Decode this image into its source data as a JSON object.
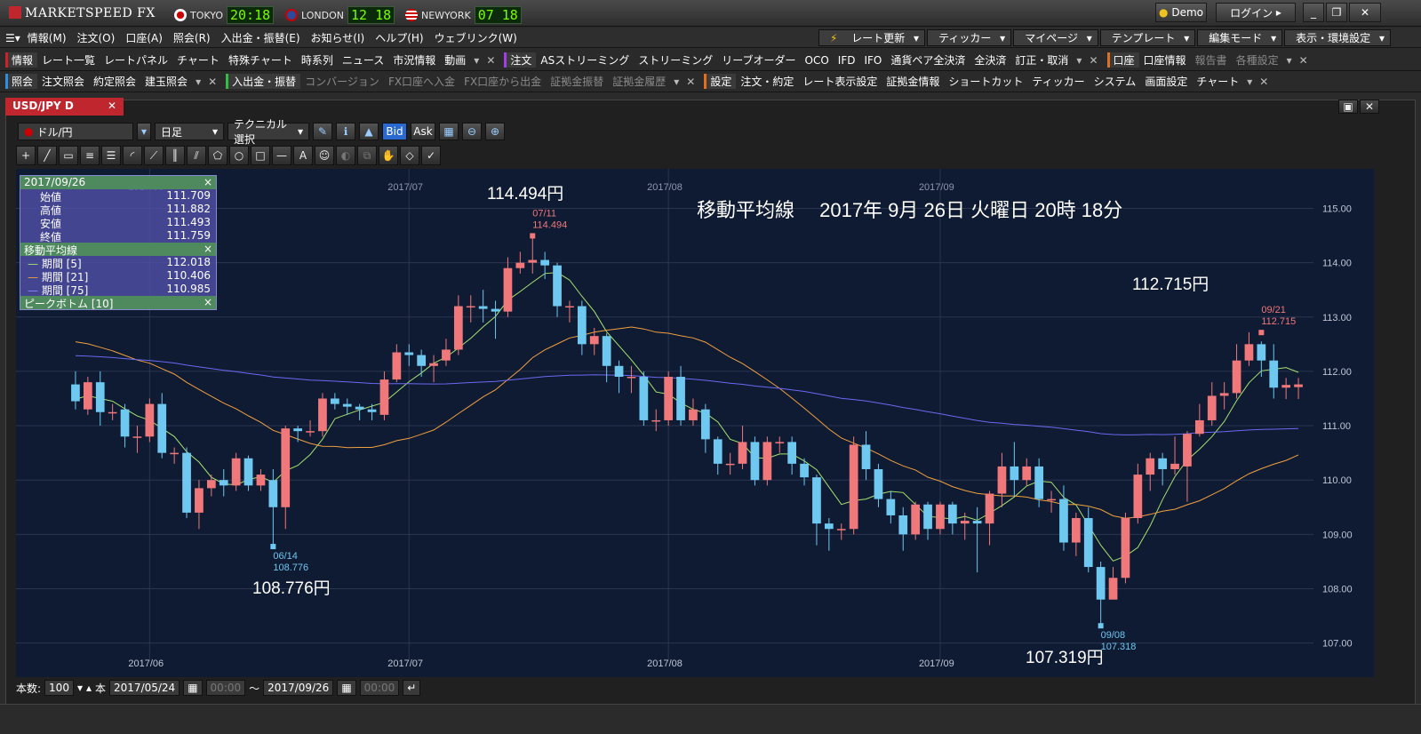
{
  "app": {
    "title": "MARKETSPEED FX"
  },
  "clocks": [
    {
      "city": "TOKYO",
      "time": "20:18"
    },
    {
      "city": "LONDON",
      "time": "12 18"
    },
    {
      "city": "NEWYORK",
      "time": "07 18"
    }
  ],
  "top_right": {
    "demo": "Demo",
    "login": "ログイン"
  },
  "menu": [
    "情報(M)",
    "注文(O)",
    "口座(A)",
    "照会(R)",
    "入出金・振替(E)",
    "お知らせ(I)",
    "ヘルプ(H)",
    "ウェブリンク(W)"
  ],
  "menu_right": [
    "レート更新",
    "ティッカー",
    "マイページ",
    "テンプレート",
    "編集モード",
    "表示・環境設定"
  ],
  "toolbar1": {
    "info_group": "情報",
    "info_items": [
      "レート一覧",
      "レートパネル",
      "チャート",
      "特殊チャート",
      "時系列",
      "ニュース",
      "市況情報",
      "動画"
    ],
    "order_group": "注文",
    "order_items": [
      "ASストリーミング",
      "ストリーミング",
      "リーブオーダー",
      "OCO",
      "IFD",
      "IFO",
      "通貨ペア全決済",
      "全決済",
      "訂正・取消"
    ],
    "account_group": "口座",
    "account_items": [
      "口座情報",
      "報告書",
      "各種設定"
    ]
  },
  "toolbar2": {
    "inquiry_group": "照会",
    "inquiry_items": [
      "注文照会",
      "約定照会",
      "建玉照会"
    ],
    "transfer_group": "入出金・振替",
    "transfer_items": [
      "コンバージョン",
      "FX口座へ入金",
      "FX口座から出金",
      "証拠金振替",
      "証拠金履歴"
    ],
    "settings_group": "設定",
    "settings_items": [
      "注文・約定",
      "レート表示設定",
      "証拠金情報",
      "ショートカット",
      "ティッカー",
      "システム",
      "画面設定",
      "チャート"
    ]
  },
  "panel": {
    "tab": "USD/JPY D",
    "pair": "ドル/円",
    "period": "日足",
    "technical": "テクニカル選択",
    "bid": "Bid",
    "ask": "Ask"
  },
  "info": {
    "date": "2017/09/26",
    "ohlc": [
      {
        "label": "始値",
        "value": "111.709"
      },
      {
        "label": "高値",
        "value": "111.882"
      },
      {
        "label": "安値",
        "value": "111.493"
      },
      {
        "label": "終値",
        "value": "111.759"
      }
    ],
    "ma_title": "移動平均線",
    "ma": [
      {
        "label": "期間 [5]",
        "value": "112.018",
        "color": "#a6e36f"
      },
      {
        "label": "期間 [21]",
        "value": "110.406",
        "color": "#f0a040"
      },
      {
        "label": "期間 [75]",
        "value": "110.985",
        "color": "#6a6af0"
      }
    ],
    "peak_title": "ピークボトム [10]"
  },
  "annotations": {
    "headline": "移動平均線　 2017年 9月 26日 火曜日 20時 18分",
    "high1": "114.494円",
    "high2": "112.715円",
    "low1": "108.776円",
    "low2": "107.319円",
    "peak1_date": "07/11",
    "peak1_val": "114.494",
    "peak2_date": "09/21",
    "peak2_val": "112.715",
    "bottom1_date": "06/14",
    "bottom1_val": "108.776",
    "bottom2_date": "09/08",
    "bottom2_val": "107.318"
  },
  "bottom": {
    "count_label": "本数:",
    "count": "100",
    "unit": "本",
    "from": "2017/05/24",
    "from_time": "00:00",
    "tilde": "〜",
    "to": "2017/09/26",
    "to_time": "00:00"
  },
  "chart_data": {
    "type": "candlestick",
    "ylim": [
      106.7,
      115.4
    ],
    "yticks": [
      "107.00",
      "108.00",
      "109.00",
      "110.00",
      "111.00",
      "112.00",
      "113.00",
      "114.00",
      "115.00"
    ],
    "xticks": [
      "2017/06",
      "2017/07",
      "2017/08",
      "2017/09"
    ],
    "colors": {
      "up": "#f0787a",
      "down": "#6ec8f0",
      "ma5": "#a6e36f",
      "ma21": "#f0a040",
      "ma75": "#6a6af0"
    },
    "candles": [
      [
        111.76,
        111.45,
        112.0,
        111.3
      ],
      [
        111.3,
        111.8,
        111.9,
        111.2
      ],
      [
        111.8,
        111.25,
        112.0,
        111.0
      ],
      [
        111.25,
        111.25,
        111.4,
        111.1
      ],
      [
        111.3,
        110.8,
        111.4,
        110.6
      ],
      [
        110.8,
        110.8,
        111.0,
        110.5
      ],
      [
        110.8,
        111.4,
        111.5,
        110.7
      ],
      [
        111.4,
        110.5,
        111.6,
        110.4
      ],
      [
        110.5,
        110.5,
        110.6,
        110.3
      ],
      [
        110.5,
        109.4,
        110.6,
        109.3
      ],
      [
        109.4,
        109.85,
        110.0,
        109.1
      ],
      [
        109.85,
        110.0,
        110.1,
        109.7
      ],
      [
        110.0,
        109.9,
        110.2,
        109.7
      ],
      [
        109.9,
        110.4,
        110.5,
        109.8
      ],
      [
        110.4,
        109.9,
        110.45,
        109.8
      ],
      [
        109.9,
        110.1,
        110.2,
        109.8
      ],
      [
        110.0,
        109.5,
        110.2,
        108.77
      ],
      [
        109.5,
        110.95,
        111.0,
        109.1
      ],
      [
        110.95,
        110.9,
        111.0,
        110.7
      ],
      [
        110.9,
        110.9,
        111.1,
        110.8
      ],
      [
        110.9,
        111.5,
        111.6,
        110.8
      ],
      [
        111.5,
        111.4,
        111.6,
        111.3
      ],
      [
        111.4,
        111.35,
        111.5,
        111.2
      ],
      [
        111.35,
        111.3,
        111.4,
        111.1
      ],
      [
        111.3,
        111.25,
        111.4,
        111.1
      ],
      [
        111.2,
        111.85,
        112.0,
        111.1
      ],
      [
        111.85,
        112.35,
        112.5,
        111.8
      ],
      [
        112.35,
        112.3,
        112.5,
        112.1
      ],
      [
        112.3,
        112.1,
        112.4,
        111.9
      ],
      [
        112.1,
        112.15,
        112.3,
        111.8
      ],
      [
        112.2,
        112.4,
        112.6,
        112.1
      ],
      [
        112.4,
        113.2,
        113.4,
        112.3
      ],
      [
        113.2,
        113.2,
        113.4,
        112.9
      ],
      [
        113.2,
        113.15,
        113.5,
        112.9
      ],
      [
        113.15,
        113.1,
        113.3,
        112.6
      ],
      [
        113.1,
        113.9,
        114.1,
        113.0
      ],
      [
        113.9,
        114.0,
        114.2,
        113.8
      ],
      [
        114.0,
        114.05,
        114.5,
        113.8
      ],
      [
        114.05,
        113.95,
        114.2,
        113.7
      ],
      [
        113.95,
        113.2,
        114.0,
        113.0
      ],
      [
        113.2,
        113.2,
        113.3,
        112.9
      ],
      [
        113.2,
        112.5,
        113.3,
        112.3
      ],
      [
        112.5,
        112.65,
        112.8,
        112.3
      ],
      [
        112.65,
        112.1,
        112.7,
        111.8
      ],
      [
        112.1,
        111.9,
        112.2,
        111.6
      ],
      [
        111.9,
        111.9,
        112.1,
        111.6
      ],
      [
        111.9,
        111.1,
        112.0,
        111.0
      ],
      [
        111.1,
        111.1,
        111.3,
        110.9
      ],
      [
        111.1,
        111.9,
        112.0,
        111.0
      ],
      [
        111.9,
        111.1,
        112.1,
        111.0
      ],
      [
        111.1,
        111.3,
        111.5,
        111.0
      ],
      [
        111.3,
        110.75,
        111.4,
        110.5
      ],
      [
        110.75,
        110.3,
        110.8,
        110.1
      ],
      [
        110.3,
        110.3,
        110.5,
        110.1
      ],
      [
        110.3,
        110.7,
        111.0,
        110.2
      ],
      [
        110.7,
        110.0,
        110.8,
        109.9
      ],
      [
        110.0,
        110.7,
        110.8,
        109.9
      ],
      [
        110.7,
        110.7,
        110.8,
        110.5
      ],
      [
        110.7,
        110.3,
        110.8,
        110.1
      ],
      [
        110.3,
        110.05,
        110.4,
        109.9
      ],
      [
        110.05,
        109.2,
        110.1,
        108.8
      ],
      [
        109.2,
        109.1,
        109.3,
        108.7
      ],
      [
        109.1,
        109.1,
        109.2,
        108.9
      ],
      [
        109.1,
        110.65,
        110.8,
        109.0
      ],
      [
        110.65,
        110.2,
        110.9,
        110.0
      ],
      [
        110.2,
        109.65,
        110.3,
        109.5
      ],
      [
        109.65,
        109.35,
        109.8,
        109.2
      ],
      [
        109.35,
        109.0,
        109.5,
        108.7
      ],
      [
        109.0,
        109.55,
        109.6,
        108.9
      ],
      [
        109.55,
        109.1,
        109.6,
        108.9
      ],
      [
        109.1,
        109.55,
        109.6,
        109.0
      ],
      [
        109.55,
        109.2,
        109.6,
        109.0
      ],
      [
        109.2,
        109.25,
        109.4,
        108.9
      ],
      [
        109.25,
        109.2,
        109.5,
        108.3
      ],
      [
        109.2,
        109.75,
        109.8,
        108.8
      ],
      [
        109.75,
        110.25,
        110.5,
        109.5
      ],
      [
        110.25,
        110.0,
        110.7,
        109.7
      ],
      [
        110.0,
        110.25,
        110.4,
        109.9
      ],
      [
        110.25,
        109.65,
        110.4,
        109.5
      ],
      [
        109.65,
        109.65,
        109.8,
        109.4
      ],
      [
        109.65,
        108.85,
        109.9,
        108.7
      ],
      [
        108.85,
        109.3,
        109.4,
        108.6
      ],
      [
        109.3,
        108.4,
        109.5,
        108.3
      ],
      [
        108.4,
        107.8,
        108.5,
        107.32
      ],
      [
        107.8,
        108.2,
        108.4,
        107.9
      ],
      [
        108.2,
        109.3,
        109.4,
        108.1
      ],
      [
        109.3,
        110.1,
        110.3,
        109.2
      ],
      [
        110.1,
        110.4,
        110.5,
        109.8
      ],
      [
        110.4,
        110.2,
        110.5,
        109.9
      ],
      [
        110.2,
        110.3,
        110.8,
        110.1
      ],
      [
        110.25,
        110.85,
        110.9,
        109.6
      ],
      [
        110.85,
        111.1,
        111.4,
        110.8
      ],
      [
        111.1,
        111.55,
        111.8,
        111.0
      ],
      [
        111.55,
        111.6,
        111.8,
        111.3
      ],
      [
        111.6,
        112.2,
        112.5,
        111.5
      ],
      [
        112.2,
        112.5,
        112.72,
        112.1
      ],
      [
        112.5,
        112.2,
        112.55,
        111.9
      ],
      [
        112.2,
        111.7,
        112.5,
        111.5
      ],
      [
        111.7,
        111.75,
        111.88,
        111.49
      ],
      [
        111.71,
        111.76,
        111.88,
        111.49
      ]
    ]
  }
}
